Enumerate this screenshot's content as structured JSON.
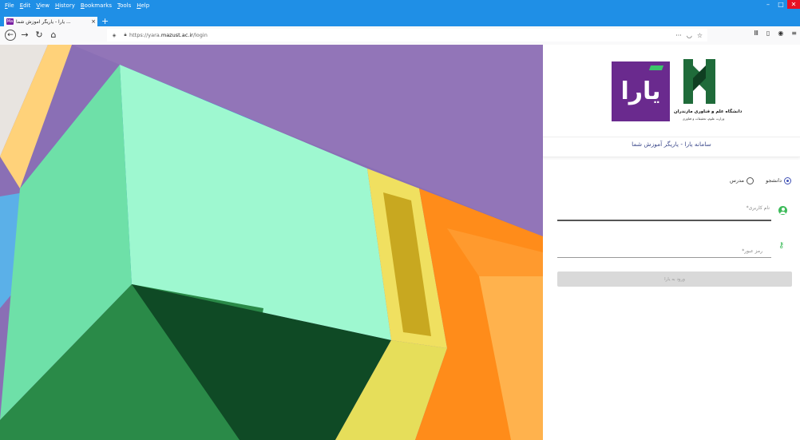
{
  "browser": {
    "menu": [
      "File",
      "Edit",
      "View",
      "History",
      "Bookmarks",
      "Tools",
      "Help"
    ],
    "tab_title": "یارا - یاریگر آموزش شما ...",
    "tab_favicon": "Ma",
    "url_prefix": "https://yara.",
    "url_domain": "mazust.ac.ir",
    "url_path": "/login",
    "window_controls": [
      "–",
      "□",
      "✕"
    ],
    "colors": {
      "chrome": "#1f8fe6",
      "close": "#e81123"
    }
  },
  "page": {
    "logo_text": "یارا",
    "university_name": "دانشگاه علم و فناوری مازندران",
    "university_sub": "وزارت علوم، تحقیقات و فناوری",
    "system_title": "سامانه یارا - یاریگر آموزش شما",
    "role_student": "دانشجو",
    "role_teacher": "مدرس",
    "selected_role": "student",
    "username_placeholder": "نام کاربری*",
    "password_placeholder": "رمز عبور*",
    "login_button": "ورود به یارا",
    "colors": {
      "accent": "#3f51b5",
      "icon_green": "#3dbb5a",
      "logo_purple": "#6a2a8e"
    }
  }
}
